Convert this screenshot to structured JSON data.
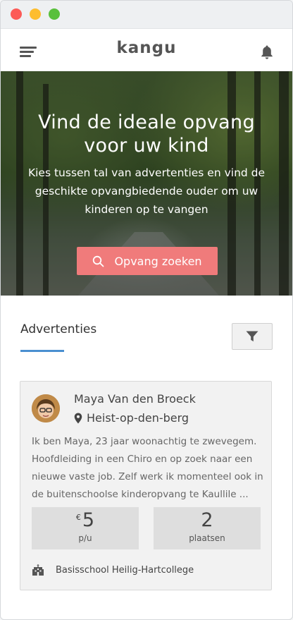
{
  "window": {
    "controls": [
      "close",
      "minimize",
      "maximize"
    ],
    "colors": {
      "close": "#fc5b57",
      "minimize": "#fdbd2f",
      "maximize": "#59c03c"
    }
  },
  "appbar": {
    "logo": "kangu",
    "menu_icon": "hamburger-menu-icon",
    "notification_icon": "bell-icon"
  },
  "hero": {
    "title": "Vind de ideale opvang voor uw kind",
    "subtitle": "Kies tussen tal van advertenties en vind de geschikte opvangbiedende ouder om uw kinderen op te vangen",
    "search_button": "Opvang zoeken",
    "search_icon": "search-icon",
    "accent_color": "#f07b7b"
  },
  "listing_section": {
    "title": "Advertenties",
    "filter_icon": "filter-icon",
    "underline_color": "#4a8fd0"
  },
  "listing": {
    "name": "Maya Van den Broeck",
    "location": "Heist-op-den-berg",
    "location_icon": "map-pin-icon",
    "description": "Ik ben Maya, 23 jaar woonachtig te zwevegem. Hoofdleiding in een Chiro en op zoek naar een nieuwe vaste job. Zelf werk ik momenteel ook in de buitenschoolse kinderopvang te Kaullile ...",
    "price": {
      "currency": "€",
      "value": "5",
      "unit": "p/u"
    },
    "places": {
      "value": "2",
      "unit": "plaatsen"
    },
    "school": "Basisschool Heilig-Hartcollege",
    "school_icon": "school-building-icon"
  }
}
